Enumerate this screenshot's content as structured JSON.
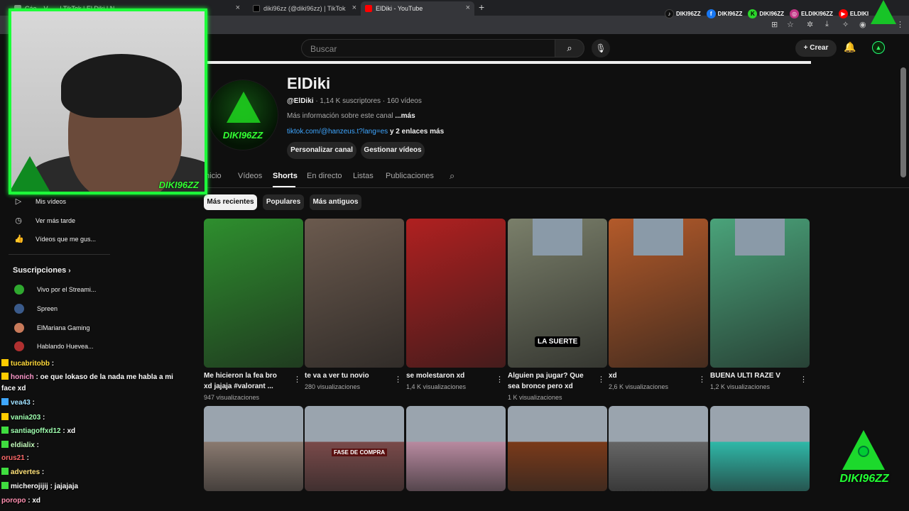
{
  "browser": {
    "tabs": [
      {
        "label": "Cáe... V... ...| TikTok | El Diki | N",
        "color": "#888"
      },
      {
        "label": "diki96zz (@diki96zz) | TikTok",
        "color": "#111"
      },
      {
        "label": "ElDiki - YouTube",
        "color": "#f00"
      }
    ],
    "new_tab": "+"
  },
  "socials": [
    {
      "label": "DIKI96ZZ",
      "color": "#111",
      "glyph": "♪"
    },
    {
      "label": "DIKI96ZZ",
      "color": "#1877f2",
      "glyph": "f"
    },
    {
      "label": "DIKI96ZZ",
      "color": "#2bd52b",
      "glyph": "K"
    },
    {
      "label": "ELDIKI96ZZ",
      "color": "#c13584",
      "glyph": "◎"
    },
    {
      "label": "ELDIKI",
      "color": "#f00",
      "glyph": "▶"
    }
  ],
  "header": {
    "search_placeholder": "Buscar",
    "create_label": "Crear"
  },
  "channel": {
    "avatar_label": "DIKI96ZZ",
    "title": "ElDiki",
    "handle": "@ElDiki",
    "meta": " · 1,14 K suscriptores · 160 vídeos",
    "desc": "Más información sobre este canal ",
    "desc_more": "...más",
    "link": "tiktok.com/@hanzeus.t?lang=es",
    "link_more": " y 2 enlaces más",
    "btn_customize": "Personalizar canal",
    "btn_manage": "Gestionar vídeos"
  },
  "tabs": [
    "Inicio",
    "Vídeos",
    "Shorts",
    "En directo",
    "Listas",
    "Publicaciones"
  ],
  "chips": [
    "Más recientes",
    "Populares",
    "Más antiguos"
  ],
  "shorts": [
    {
      "title_l1": "Me hicieron la fea bro",
      "title_l2": "xd jajaja #valorant ...",
      "views": "947 visualizaciones",
      "bg": "#2e8f2e"
    },
    {
      "title_l1": "te va a ver tu novio",
      "title_l2": "",
      "views": "280 visualizaciones",
      "bg": "#6b5a4e"
    },
    {
      "title_l1": "se molestaron xd",
      "title_l2": "",
      "views": "1,4 K visualizaciones",
      "bg": "#b02020"
    },
    {
      "title_l1": "Alguien pa jugar? Que",
      "title_l2": "sea bronce pero xd",
      "views": "1 K visualizaciones",
      "bg": "#7a7f6a",
      "overlay": "LA SUERTE"
    },
    {
      "title_l1": "xd",
      "title_l2": "",
      "views": "2,6 K visualizaciones",
      "bg": "#b35a2a"
    },
    {
      "title_l1": "BUENA ULTI RAZE V",
      "title_l2": "",
      "views": "1,2 K visualizaciones",
      "bg": "#4aa37a"
    }
  ],
  "shorts_row2": [
    {
      "bg": "#8a7a70",
      "overlay": ""
    },
    {
      "bg": "#7a4a4a",
      "overlay": "FASE DE COMPRA"
    },
    {
      "bg": "#b88aa0",
      "overlay": ""
    },
    {
      "bg": "#7a3a1a",
      "overlay": ""
    },
    {
      "bg": "#666",
      "overlay": ""
    },
    {
      "bg": "#2fb8a8",
      "overlay": ""
    }
  ],
  "sidebar": {
    "items": [
      {
        "label": "Mis vídeos",
        "icon": "▷"
      },
      {
        "label": "Ver más tarde",
        "icon": "◷"
      },
      {
        "label": "Vídeos que me gus...",
        "icon": "👍"
      }
    ],
    "subs_title": "Suscripciones",
    "subs": [
      {
        "label": "Vivo por el Streami...",
        "color": "#2fa82f"
      },
      {
        "label": "Spreen",
        "color": "#3a5a8a"
      },
      {
        "label": "ElMariana Gaming",
        "color": "#c87a5a"
      },
      {
        "label": "Hablando Huevea...",
        "color": "#b03030"
      }
    ]
  },
  "webcam": {
    "tag": "DIKI96ZZ"
  },
  "chat": [
    {
      "user": "tucabritobb",
      "ucolor": "#ffd93b",
      "text": " :",
      "badge": "#ffcc00"
    },
    {
      "user": "honich",
      "ucolor": "#ff99cc",
      "text": " : oe que lokaso de la nada me habla a mi",
      "badge": "#ffcc00"
    },
    {
      "user": "",
      "ucolor": "#fff",
      "text": "face xd",
      "badge": ""
    },
    {
      "user": "vea43",
      "ucolor": "#9fe0ff",
      "text": " :",
      "badge": "#3fa7ff"
    },
    {
      "user": "vania203",
      "ucolor": "#9fffb0",
      "text": " :",
      "badge": "#ffcc00"
    },
    {
      "user": "santiagoffxd12",
      "ucolor": "#9fffb0",
      "text": " : xd",
      "badge": "#3fdc3f"
    },
    {
      "user": "eldialix",
      "ucolor": "#c7ffbf",
      "text": " :",
      "badge": "#3fdc3f"
    },
    {
      "user": "orus21",
      "ucolor": "#ff6a6a",
      "text": " :",
      "badge": ""
    },
    {
      "user": "advertes",
      "ucolor": "#ffe27a",
      "text": " :",
      "badge": "#3fdc3f"
    },
    {
      "user": "micherojijij",
      "ucolor": "#ffffff",
      "text": " : jajajaja",
      "badge": "#3fdc3f"
    },
    {
      "user": "poropo",
      "ucolor": "#ff8fb0",
      "text": " : xd",
      "badge": ""
    }
  ],
  "brand_logo_label": "DIKI96ZZ"
}
